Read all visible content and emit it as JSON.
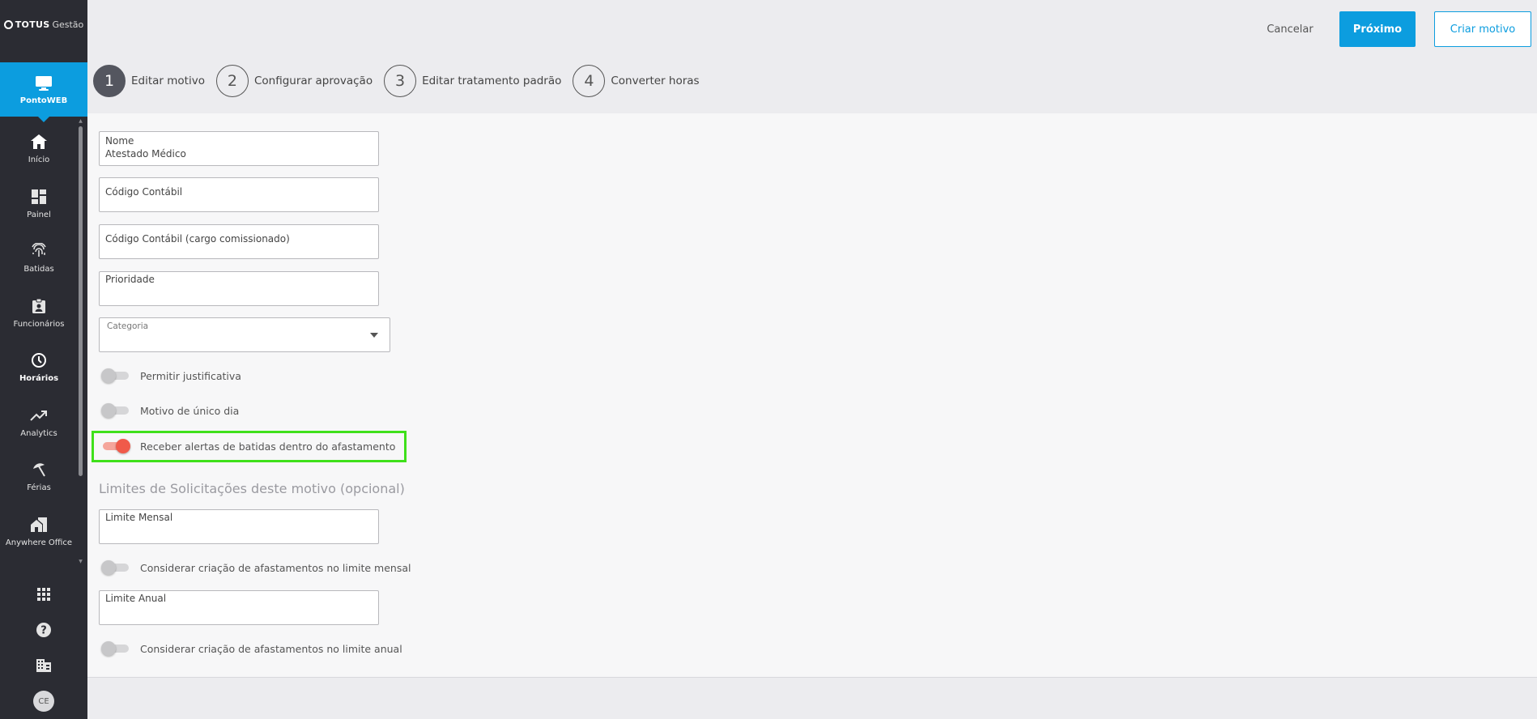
{
  "brand": {
    "name": "TOTUS",
    "product": "Gestão"
  },
  "app_tile": {
    "label": "PontoWEB"
  },
  "sidebar": {
    "items": [
      {
        "label": "Início",
        "icon": "home-icon"
      },
      {
        "label": "Painel",
        "icon": "dashboard-icon"
      },
      {
        "label": "Batidas",
        "icon": "fingerprint-icon"
      },
      {
        "label": "Funcionários",
        "icon": "badge-icon"
      },
      {
        "label": "Horários",
        "icon": "clock-icon",
        "active": true
      },
      {
        "label": "Analytics",
        "icon": "trending-up-icon"
      },
      {
        "label": "Férias",
        "icon": "beach-umbrella-icon"
      },
      {
        "label": "Anywhere Office",
        "icon": "home-work-icon"
      }
    ],
    "bottom": [
      "apps-grid-icon",
      "help-icon",
      "company-icon"
    ],
    "avatar_initials": "CE"
  },
  "header": {
    "cancel_label": "Cancelar",
    "next_label": "Próximo",
    "create_label": "Criar motivo"
  },
  "steps": [
    {
      "num": "1",
      "label": "Editar motivo",
      "current": true
    },
    {
      "num": "2",
      "label": "Configurar aprovação"
    },
    {
      "num": "3",
      "label": "Editar tratamento padrão"
    },
    {
      "num": "4",
      "label": "Converter horas"
    }
  ],
  "form": {
    "nome": {
      "label": "Nome",
      "value": "Atestado Médico"
    },
    "codigo_contabil": {
      "label": "Código Contábil"
    },
    "codigo_comissionado": {
      "label": "Código Contábil (cargo comissionado)"
    },
    "prioridade": {
      "label": "Prioridade"
    },
    "categoria": {
      "label": "Categoria"
    },
    "toggles": {
      "permitir_justificativa": {
        "label": "Permitir justificativa",
        "on": false
      },
      "unico_dia": {
        "label": "Motivo de único dia",
        "on": false
      },
      "receber_alertas": {
        "label": "Receber alertas de batidas dentro do afastamento",
        "on": true
      }
    },
    "limites_title": "Limites de Solicitações deste motivo (opcional)",
    "limite_mensal": {
      "label": "Limite Mensal"
    },
    "considerar_mensal": {
      "label": "Considerar criação de afastamentos no limite mensal",
      "on": false
    },
    "limite_anual": {
      "label": "Limite Anual"
    },
    "considerar_anual": {
      "label": "Considerar criação de afastamentos no limite anual",
      "on": false
    }
  },
  "colors": {
    "accent": "#0c9ddf",
    "sidebar": "#2b2c33",
    "toggle_on": "#f05a4a",
    "highlight": "#3fe01b"
  }
}
